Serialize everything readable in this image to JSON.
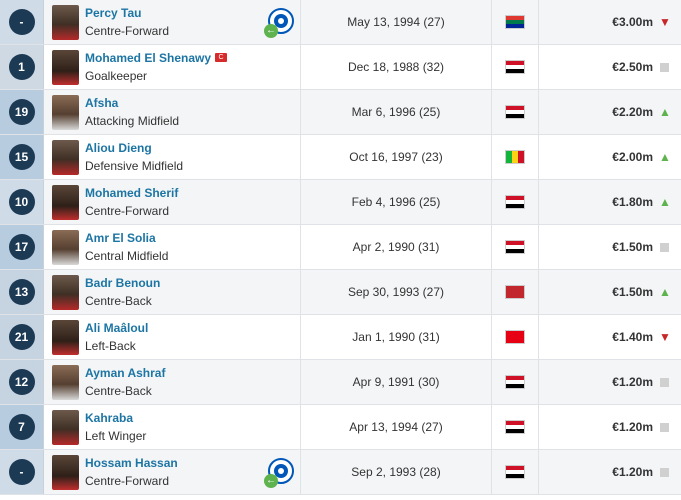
{
  "players": [
    {
      "number": "-",
      "name": "Percy Tau",
      "position": "Centre-Forward",
      "dob": "May 13, 1994 (27)",
      "flag": "south-africa",
      "value": "€3.00m",
      "trend": "down",
      "captain": false,
      "club_icon": "brighton-club-icon",
      "loan": true
    },
    {
      "number": "1",
      "name": "Mohamed El Shenawy",
      "position": "Goalkeeper",
      "dob": "Dec 18, 1988 (32)",
      "flag": "egypt",
      "value": "€2.50m",
      "trend": "same",
      "captain": true
    },
    {
      "number": "19",
      "name": "Afsha",
      "position": "Attacking Midfield",
      "dob": "Mar 6, 1996 (25)",
      "flag": "egypt",
      "value": "€2.20m",
      "trend": "up",
      "captain": false
    },
    {
      "number": "15",
      "name": "Aliou Dieng",
      "position": "Defensive Midfield",
      "dob": "Oct 16, 1997 (23)",
      "flag": "mali",
      "value": "€2.00m",
      "trend": "up",
      "captain": false
    },
    {
      "number": "10",
      "name": "Mohamed Sherif",
      "position": "Centre-Forward",
      "dob": "Feb 4, 1996 (25)",
      "flag": "egypt",
      "value": "€1.80m",
      "trend": "up",
      "captain": false
    },
    {
      "number": "17",
      "name": "Amr El Solia",
      "position": "Central Midfield",
      "dob": "Apr 2, 1990 (31)",
      "flag": "egypt",
      "value": "€1.50m",
      "trend": "same",
      "captain": false
    },
    {
      "number": "13",
      "name": "Badr Benoun",
      "position": "Centre-Back",
      "dob": "Sep 30, 1993 (27)",
      "flag": "morocco",
      "value": "€1.50m",
      "trend": "up",
      "captain": false
    },
    {
      "number": "21",
      "name": "Ali Maâloul",
      "position": "Left-Back",
      "dob": "Jan 1, 1990 (31)",
      "flag": "tunisia",
      "value": "€1.40m",
      "trend": "down",
      "captain": false
    },
    {
      "number": "12",
      "name": "Ayman Ashraf",
      "position": "Centre-Back",
      "dob": "Apr 9, 1991 (30)",
      "flag": "egypt",
      "value": "€1.20m",
      "trend": "same",
      "captain": false
    },
    {
      "number": "7",
      "name": "Kahraba",
      "position": "Left Winger",
      "dob": "Apr 13, 1994 (27)",
      "flag": "egypt",
      "value": "€1.20m",
      "trend": "same",
      "captain": false
    },
    {
      "number": "-",
      "name": "Hossam Hassan",
      "position": "Centre-Forward",
      "dob": "Sep 2, 1993 (28)",
      "flag": "egypt",
      "value": "€1.20m",
      "trend": "same",
      "captain": false,
      "club_icon": "smouha-club-icon",
      "loan": true
    }
  ],
  "captain_mark": "C",
  "icons": {
    "up": "▲",
    "down": "▼",
    "loan": "←"
  }
}
